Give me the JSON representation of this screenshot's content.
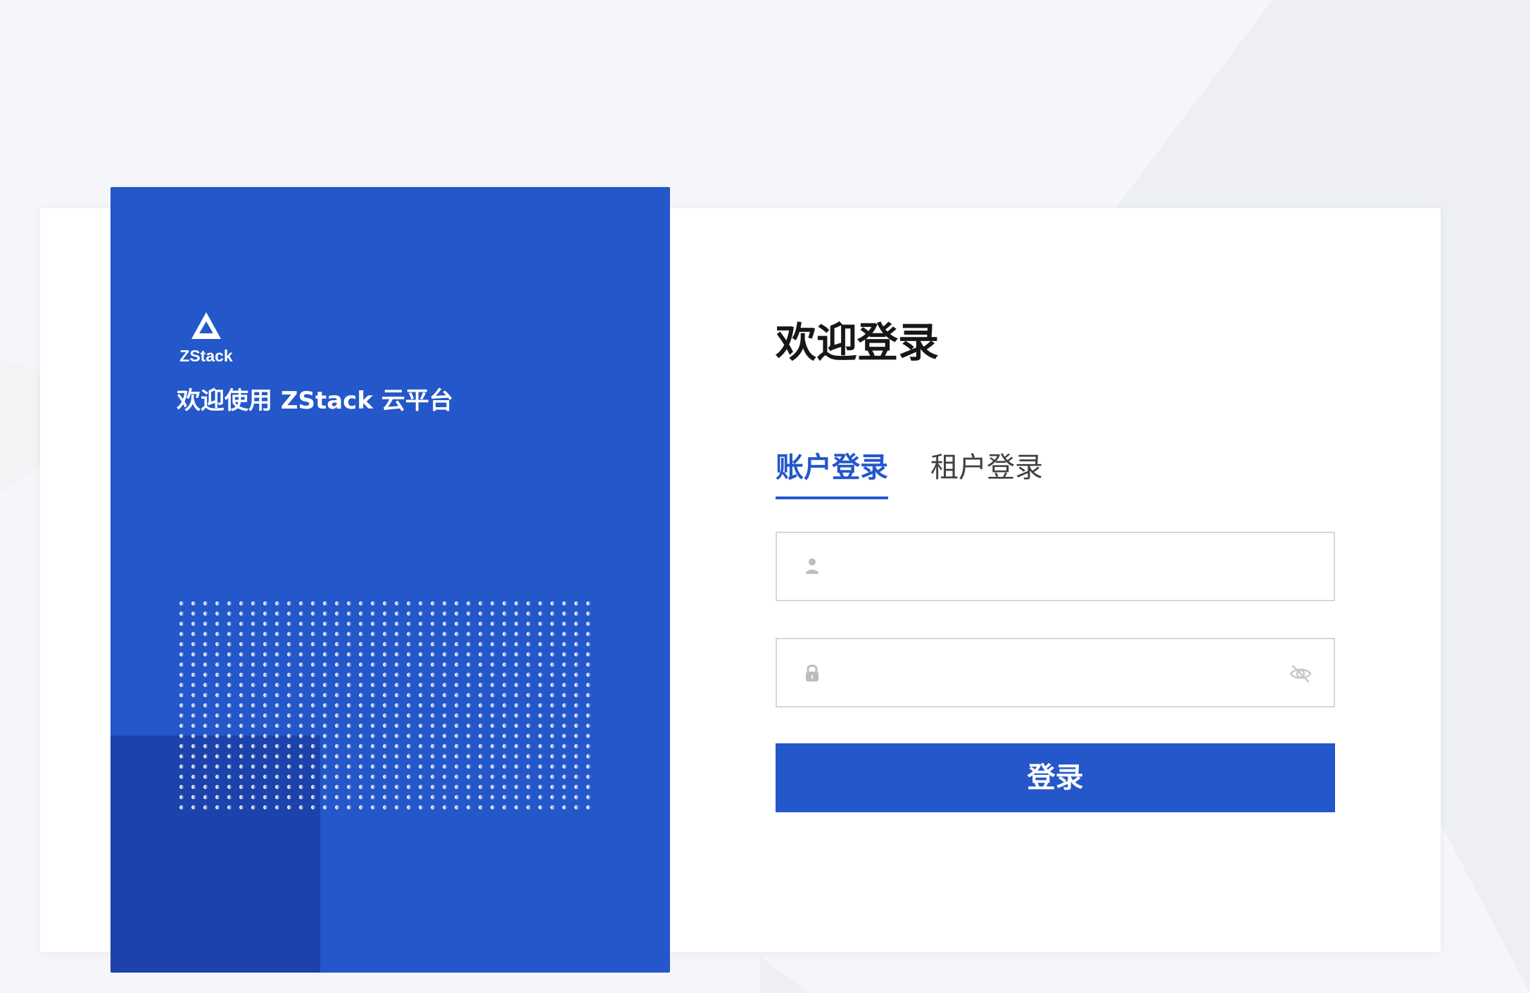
{
  "colors": {
    "page_background": "#f4f6f9",
    "card_background": "#ffffff",
    "brand_blue": "#2457c9",
    "brand_dark_blue": "#1c43ab",
    "text_primary": "#171717",
    "input_border": "#d7d7d7"
  },
  "brand": {
    "logo_text": "ZStack",
    "welcome_text": "欢迎使用 ZStack 云平台",
    "logo_icon": "zstack-logo-icon",
    "decoration_icon": "dot-grid-decoration"
  },
  "login": {
    "title": "欢迎登录",
    "tabs": [
      {
        "label": "账户登录",
        "active": true
      },
      {
        "label": "租户登录",
        "active": false
      }
    ],
    "username": {
      "value": "",
      "placeholder": "",
      "icon": "user-icon"
    },
    "password": {
      "value": "",
      "placeholder": "",
      "icon": "lock-icon",
      "toggle_icon": "eye-off-icon"
    },
    "submit_label": "登录"
  }
}
